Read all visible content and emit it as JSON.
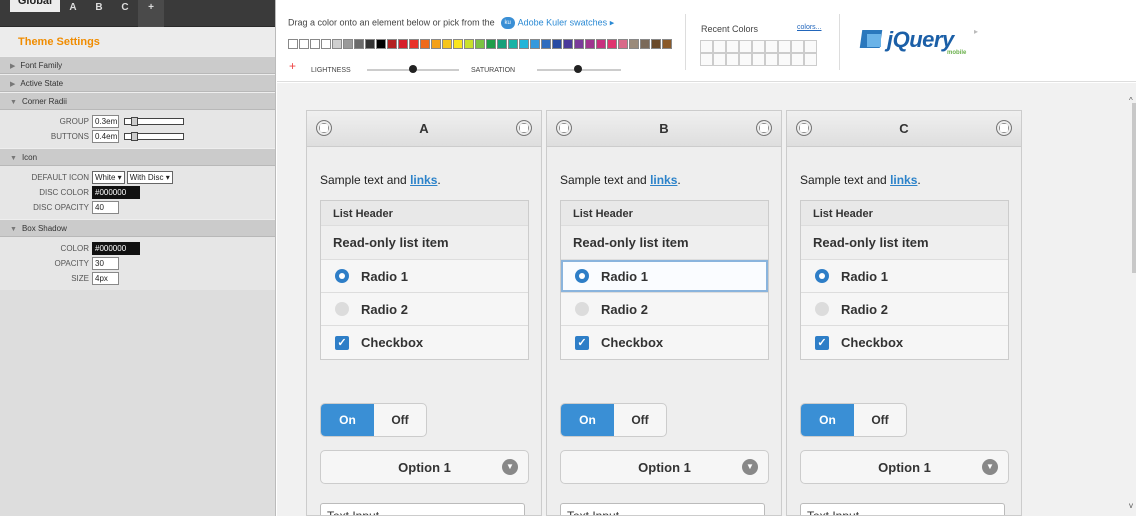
{
  "sidebar": {
    "tabs": [
      "Global",
      "A",
      "B",
      "C",
      "+"
    ],
    "theme_title": "Theme Settings",
    "sections": {
      "font_family": "Font Family",
      "active_state": "Active State",
      "corner_radii": "Corner Radii",
      "icon": "Icon",
      "box_shadow": "Box Shadow"
    },
    "corner_radii": {
      "group_label": "GROUP",
      "group_value": "0.3em",
      "buttons_label": "BUTTONS",
      "buttons_value": "0.4em"
    },
    "icon": {
      "default_icon_label": "DEFAULT ICON",
      "default_icon_value": "White",
      "disc_style_value": "With Disc",
      "disc_color_label": "DISC COLOR",
      "disc_color_value": "#000000",
      "disc_opacity_label": "DISC OPACITY",
      "disc_opacity_value": "40"
    },
    "box_shadow": {
      "color_label": "COLOR",
      "color_value": "#000000",
      "opacity_label": "OPACITY",
      "opacity_value": "30",
      "size_label": "SIZE",
      "size_value": "4px"
    }
  },
  "topbar": {
    "drag_text": "Drag a color onto an element below or pick from the",
    "kuler_badge": "ku",
    "kuler_link": "Adobe Kuler swatches",
    "kuler_arrow": "▸",
    "lightness_label": "LIGHTNESS",
    "saturation_label": "SATURATION",
    "recent_colors_label": "Recent Colors",
    "colors_link": "colors...",
    "logo_text": "jQuery",
    "logo_sub": "mobile",
    "logo_arrow": "▸"
  },
  "swatch_colors": [
    "#ffffff",
    "#ffffff",
    "#ffffff",
    "#ffffff",
    "#cfcfcf",
    "#9a9a9a",
    "#6a6a6a",
    "#333333",
    "#000000",
    "#b22222",
    "#d61f2c",
    "#e8322a",
    "#ef6a1a",
    "#f4a11a",
    "#f6c51b",
    "#f9e51f",
    "#c9e02a",
    "#7cc242",
    "#1f9e4a",
    "#15a07a",
    "#19b3a5",
    "#22b5d8",
    "#3399dd",
    "#2f6dbf",
    "#2a4ca3",
    "#4a3a9a",
    "#7a3a9a",
    "#a0358f",
    "#c8307e",
    "#e0356f",
    "#d86a8a",
    "#9a8a7a",
    "#7a6a5a",
    "#6a4a2a",
    "#8a5a2a"
  ],
  "swatches": [
    {
      "letter": "A",
      "sample_text": "Sample text and ",
      "sample_link": "links",
      "sample_end": ".",
      "list_header": "List Header",
      "read_only": "Read-only list item",
      "radio1": "Radio 1",
      "radio2": "Radio 2",
      "checkbox": "Checkbox",
      "flip_on": "On",
      "flip_off": "Off",
      "select": "Option 1",
      "text_input": "Text Input"
    },
    {
      "letter": "B",
      "sample_text": "Sample text and ",
      "sample_link": "links",
      "sample_end": ".",
      "list_header": "List Header",
      "read_only": "Read-only list item",
      "radio1": "Radio 1",
      "radio2": "Radio 2",
      "checkbox": "Checkbox",
      "flip_on": "On",
      "flip_off": "Off",
      "select": "Option 1",
      "text_input": "Text Input"
    },
    {
      "letter": "C",
      "sample_text": "Sample text and ",
      "sample_link": "links",
      "sample_end": ".",
      "list_header": "List Header",
      "read_only": "Read-only list item",
      "radio1": "Radio 1",
      "radio2": "Radio 2",
      "checkbox": "Checkbox",
      "flip_on": "On",
      "flip_off": "Off",
      "select": "Option 1",
      "text_input": "Text Input"
    }
  ],
  "colors": {
    "accent_orange": "#f08c00",
    "accent_blue": "#3a8fd5",
    "link_blue": "#2b82c9"
  }
}
